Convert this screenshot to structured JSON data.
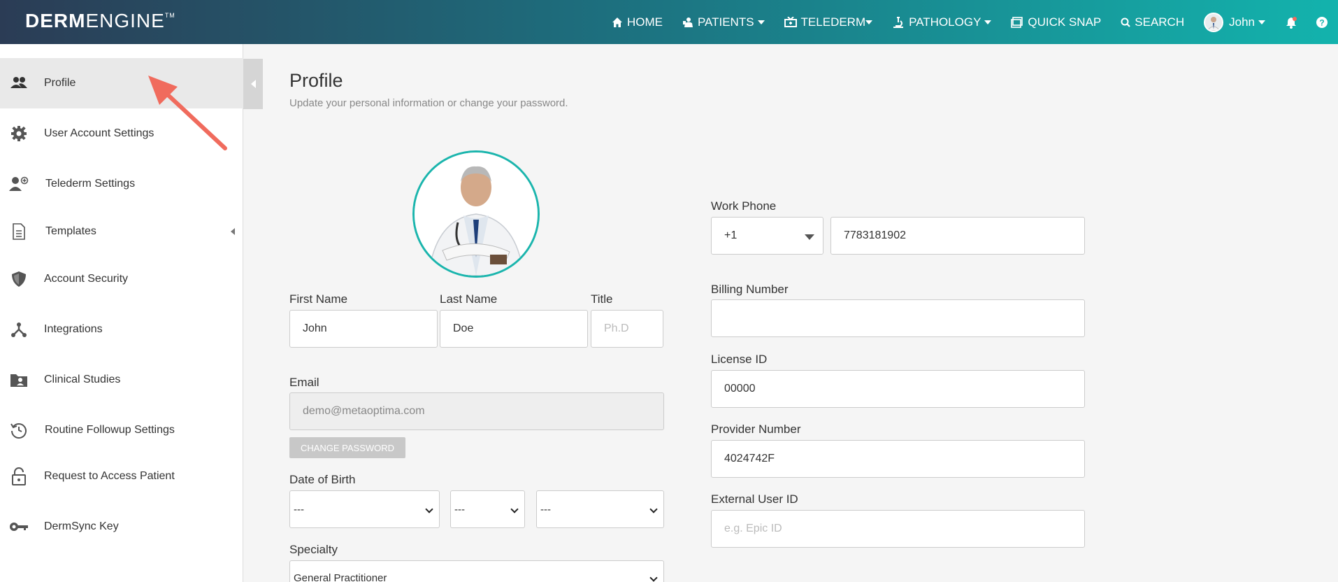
{
  "brand": {
    "bold": "DERM",
    "thin": "ENGINE",
    "tm": "TM"
  },
  "nav": {
    "home": "HOME",
    "patients": "PATIENTS",
    "telederm": "TELEDERM",
    "pathology": "PATHOLOGY",
    "quick_snap": "QUICK SNAP",
    "search": "SEARCH",
    "user": "John"
  },
  "sidebar": {
    "items": [
      {
        "label": "Profile",
        "icon": "people-icon"
      },
      {
        "label": "User Account Settings",
        "icon": "gear-icon"
      },
      {
        "label": "Telederm Settings",
        "icon": "user-plus-icon"
      },
      {
        "label": "Templates",
        "icon": "document-icon"
      },
      {
        "label": "Account Security",
        "icon": "shield-icon"
      },
      {
        "label": "Integrations",
        "icon": "integrations-icon"
      },
      {
        "label": "Clinical Studies",
        "icon": "folder-user-icon"
      },
      {
        "label": "Routine Followup Settings",
        "icon": "history-icon"
      },
      {
        "label": "Request to Access Patient",
        "icon": "lock-open-icon"
      },
      {
        "label": "DermSync Key",
        "icon": "key-icon"
      }
    ]
  },
  "main": {
    "title": "Profile",
    "subtitle": "Update your personal information or change your password.",
    "first_name": {
      "label": "First Name",
      "value": "John"
    },
    "last_name": {
      "label": "Last Name",
      "value": "Doe"
    },
    "title_field": {
      "label": "Title",
      "placeholder": "Ph.D"
    },
    "email": {
      "label": "Email",
      "value": "demo@metaoptima.com"
    },
    "change_password": "CHANGE PASSWORD",
    "dob": {
      "label": "Date of Birth",
      "day": "---",
      "month": "---",
      "year": "---"
    },
    "specialty": {
      "label": "Specialty",
      "value": "General Practitioner"
    },
    "work_phone": {
      "label": "Work Phone",
      "code": "+1",
      "value": "7783181902"
    },
    "billing_number": {
      "label": "Billing Number",
      "value": ""
    },
    "license_id": {
      "label": "License ID",
      "value": "00000"
    },
    "provider_number": {
      "label": "Provider Number",
      "value": "4024742F"
    },
    "external_user_id": {
      "label": "External User ID",
      "placeholder": "e.g. Epic ID"
    }
  },
  "colors": {
    "accent": "#1bb5ad",
    "annotation_arrow": "#f06b5d"
  }
}
